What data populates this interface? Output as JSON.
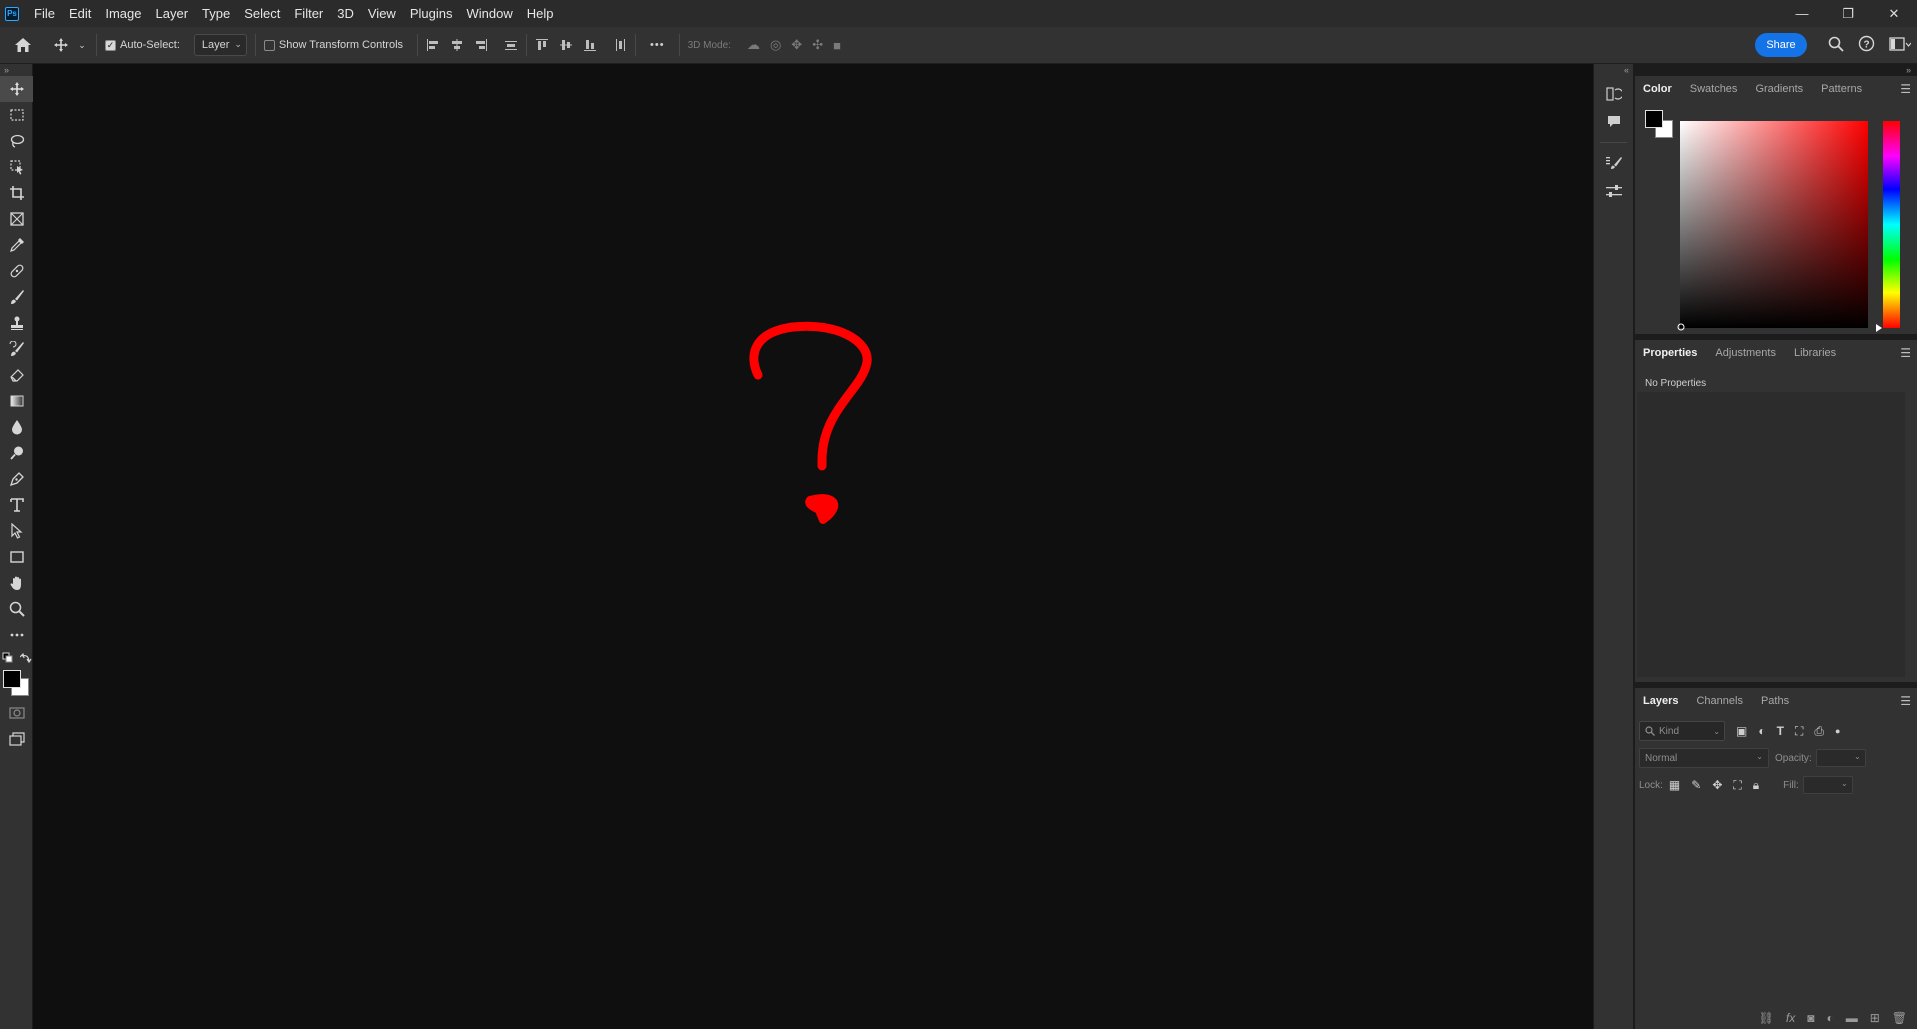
{
  "app": {
    "logo_text": "Ps"
  },
  "menu": [
    "File",
    "Edit",
    "Image",
    "Layer",
    "Type",
    "Select",
    "Filter",
    "3D",
    "View",
    "Plugins",
    "Window",
    "Help"
  ],
  "window_controls": {
    "minimize": "—",
    "restore": "❐",
    "close": "✕"
  },
  "options_bar": {
    "auto_select_label": "Auto-Select:",
    "auto_select_target": "Layer",
    "show_transform_label": "Show Transform Controls",
    "more": "•••",
    "mode_3d_label": "3D Mode:",
    "share_label": "Share"
  },
  "colors": {
    "accent": "#1473e6",
    "foreground": "#000000",
    "background": "#ffffff",
    "stroke": "#ff0000"
  },
  "panels": {
    "color": {
      "tabs": [
        "Color",
        "Swatches",
        "Gradients",
        "Patterns"
      ],
      "active": "Color"
    },
    "properties": {
      "tabs": [
        "Properties",
        "Adjustments",
        "Libraries"
      ],
      "active": "Properties",
      "empty_text": "No Properties"
    },
    "layers": {
      "tabs": [
        "Layers",
        "Channels",
        "Paths"
      ],
      "active": "Layers",
      "kind_placeholder": "Kind",
      "blend_mode": "Normal",
      "opacity_label": "Opacity:",
      "lock_label": "Lock:",
      "fill_label": "Fill:"
    }
  }
}
